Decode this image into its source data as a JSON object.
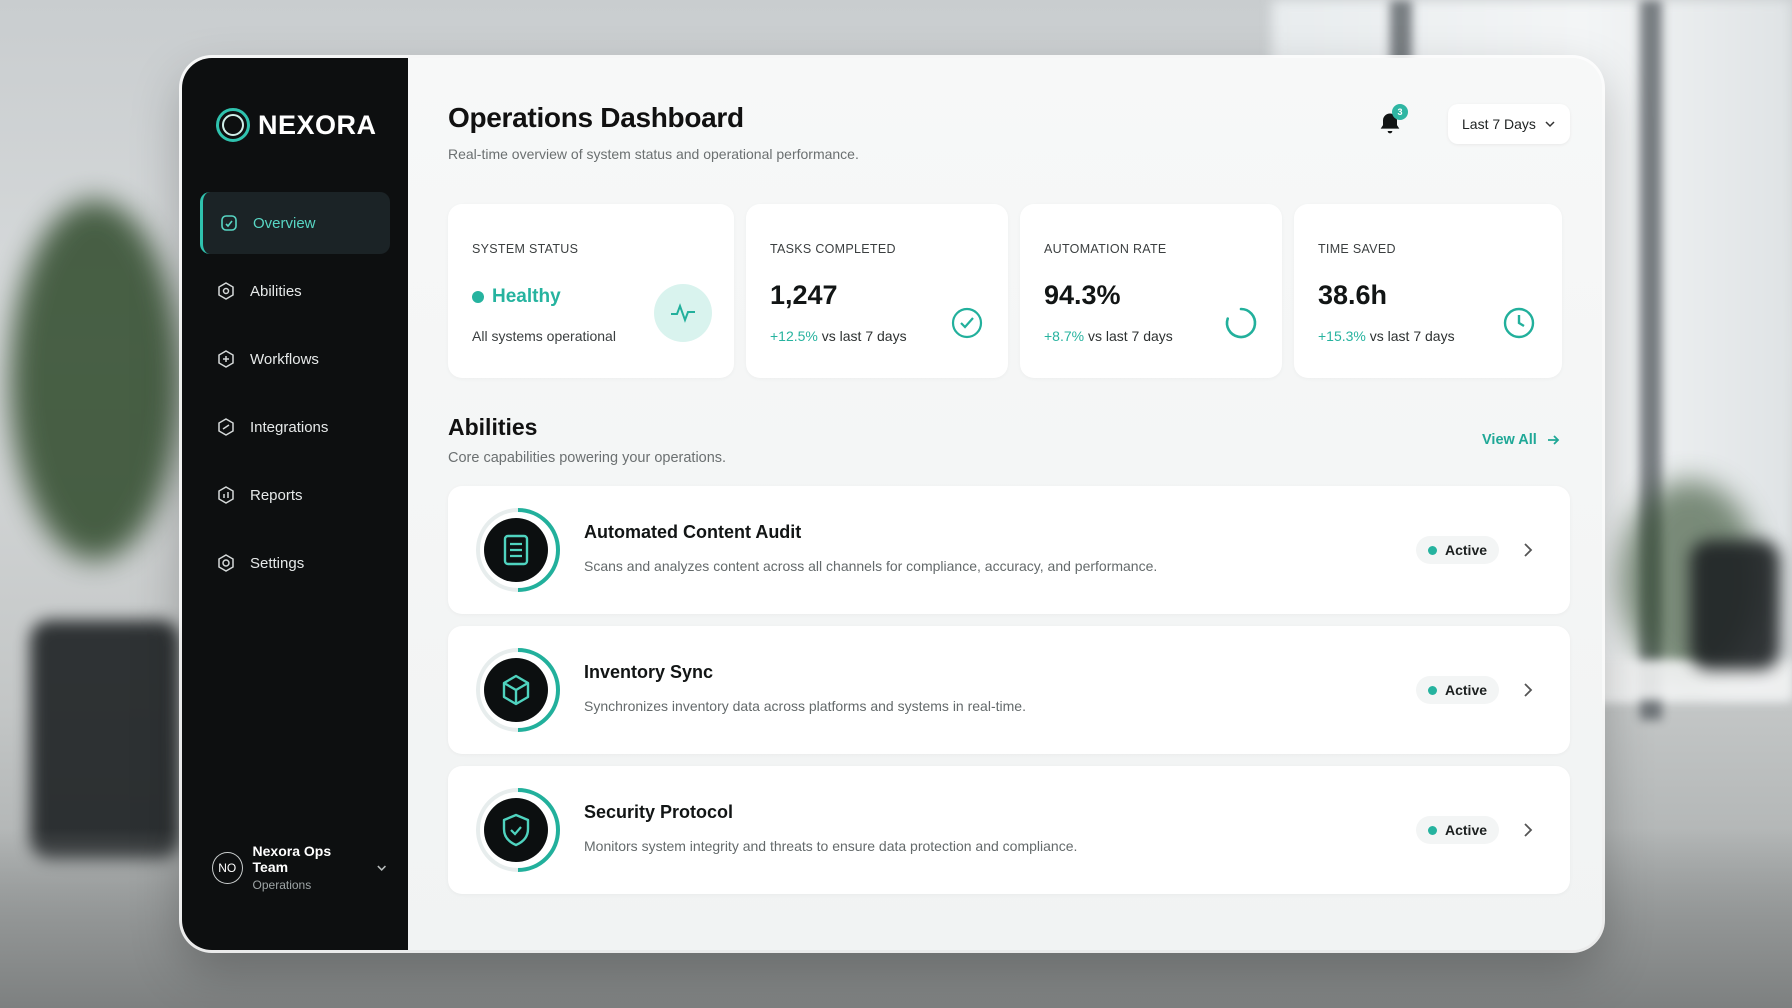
{
  "brand": {
    "name": "NEXORA",
    "accent": "#2fc2ae"
  },
  "sidebar": {
    "items": [
      {
        "label": "Overview",
        "icon": "overview-icon",
        "active": true
      },
      {
        "label": "Abilities",
        "icon": "abilities-icon",
        "active": false
      },
      {
        "label": "Workflows",
        "icon": "workflows-icon",
        "active": false
      },
      {
        "label": "Integrations",
        "icon": "integrations-icon",
        "active": false
      },
      {
        "label": "Reports",
        "icon": "reports-icon",
        "active": false
      },
      {
        "label": "Settings",
        "icon": "gear-icon",
        "active": false
      }
    ],
    "team": {
      "initials": "NO",
      "name": "Nexora Ops Team",
      "role": "Operations"
    }
  },
  "header": {
    "title": "Operations Dashboard",
    "subtitle": "Real-time overview of system status and operational performance.",
    "notifications_count": "3",
    "range": "Last 7 Days"
  },
  "stats": {
    "system_status": {
      "label": "SYSTEM STATUS",
      "value": "Healthy",
      "sub": "All systems operational",
      "icon": "pulse-icon"
    },
    "tasks": {
      "label": "TASKS COMPLETED",
      "value": "1,247",
      "delta": "+12.5%",
      "delta_suffix": " vs last 7 days",
      "icon": "check-circle-icon"
    },
    "automation": {
      "label": "AUTOMATION RATE",
      "value": "94.3%",
      "delta": "+8.7%",
      "delta_suffix": " vs last 7 days",
      "icon": "progress-ring-icon"
    },
    "time_saved": {
      "label": "TIME SAVED",
      "value": "38.6h",
      "delta": "+15.3%",
      "delta_suffix": " vs last 7 days",
      "icon": "clock-icon"
    }
  },
  "abilities": {
    "title": "Abilities",
    "subtitle": "Core capabilities powering your operations.",
    "view_all": "View All",
    "items": [
      {
        "title": "Automated Content Audit",
        "desc": "Scans and analyzes content across all channels for compliance, accuracy, and performance.",
        "status": "Active",
        "icon": "document-icon"
      },
      {
        "title": "Inventory Sync",
        "desc": "Synchronizes inventory data across platforms and systems in real-time.",
        "status": "Active",
        "icon": "cube-icon"
      },
      {
        "title": "Security Protocol",
        "desc": "Monitors system integrity and threats to ensure data protection and compliance.",
        "status": "Active",
        "icon": "shield-icon"
      }
    ]
  }
}
